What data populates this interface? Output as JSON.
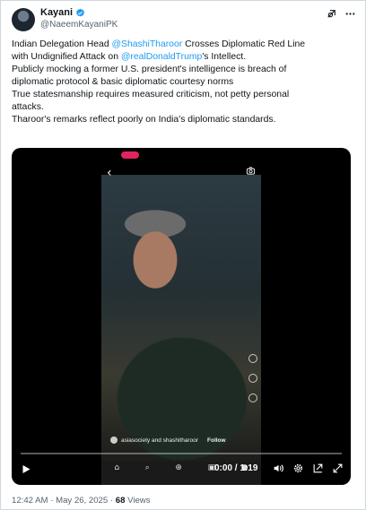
{
  "author": {
    "display_name": "Kayani",
    "handle": "@NaeemKayaniPK"
  },
  "tweet": {
    "line1_pre": "Indian Delegation Head ",
    "line1_mention": "@ShashiTharoor",
    "line1_post": " Crosses Diplomatic Red Line",
    "line2_pre": "with Undignified Attack on ",
    "line2_mention": "@realDonaldTrump",
    "line2_post": "'s Intellect.",
    "line3": "Publicly mocking a former U.S. president's intelligence is breach of",
    "line4": "diplomatic protocol & basic diplomatic courtesy norms",
    "line5": "True statesmanship requires measured criticism, not petty personal",
    "line6": "attacks.",
    "line7": "Tharoor's remarks reflect poorly on India's diplomatic standards."
  },
  "video": {
    "caption_account": "asiasociety and shashitharoor",
    "caption_follow": "Follow",
    "current_time": "0:00",
    "duration": "1:19",
    "time_separator": " / ",
    "progress_fraction": 0.0,
    "status_time": "◦ ▪ ▮"
  },
  "meta": {
    "time": "12:42 AM",
    "separator": " · ",
    "date": "May 26, 2025",
    "views_count": "68",
    "views_label": " Views"
  },
  "colors": {
    "accent": "#1d9bf0",
    "verified": "#1d9bf0",
    "muted": "#536471"
  },
  "icons": [
    "verified-icon",
    "grok-icon",
    "more-icon",
    "play-icon",
    "volume-icon",
    "settings-icon",
    "pip-icon",
    "fullscreen-icon",
    "back-arrow-icon",
    "camera-icon"
  ]
}
